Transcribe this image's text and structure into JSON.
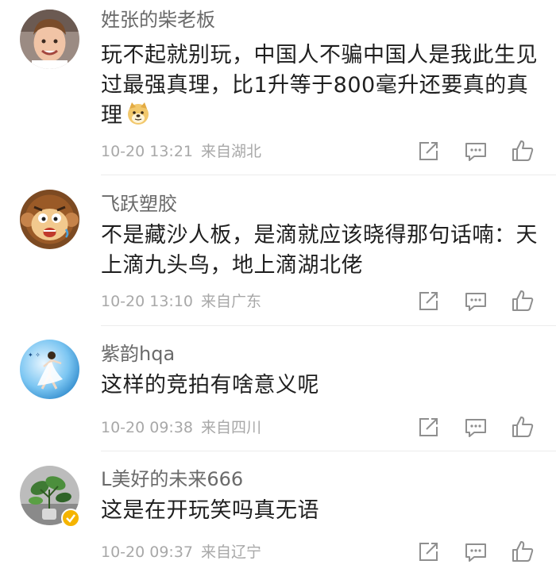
{
  "comments": [
    {
      "username": "姓张的柴老板",
      "text": "玩不起就别玩，中国人不骗中国人是我此生见过最强真理，比1升等于800毫升还要真的真理",
      "emoji": "doge-emoji",
      "time": "10-20 13:21",
      "location": "来自湖北",
      "avatar": "boy-photo-avatar"
    },
    {
      "username": "飞跃塑胶",
      "text": "不是藏沙人板，是滴就应该晓得那句话喃：天上滴九头鸟，地上滴湖北佬",
      "time": "10-20 13:10",
      "location": "来自广东",
      "avatar": "cartoon-monkey-avatar"
    },
    {
      "username": "紫韵hqa",
      "text": "这样的竞拍有啥意义呢",
      "time": "10-20 09:38",
      "location": "来自四川",
      "avatar": "dancer-avatar"
    },
    {
      "username": "L美好的未来666",
      "text": "这是在开玩笑吗真无语",
      "time": "10-20 09:37",
      "location": "来自辽宁",
      "avatar": "plant-photo-avatar",
      "verified": true
    }
  ],
  "actions": {
    "repost_icon": "repost-icon",
    "comment_icon": "comment-icon",
    "like_icon": "like-icon"
  },
  "colors": {
    "username": "#6a6a6a",
    "text": "#1f1f1f",
    "meta": "#a8a8a8",
    "divider": "#ececec",
    "verified_badge": "#f5b400"
  }
}
